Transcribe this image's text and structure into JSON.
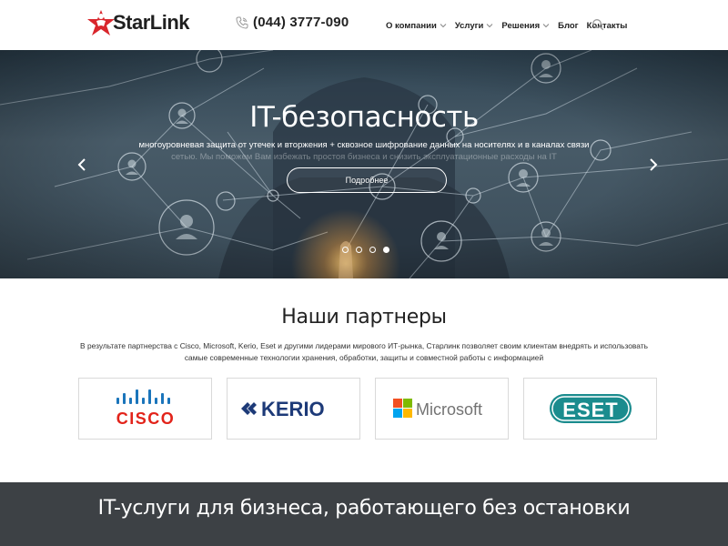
{
  "header": {
    "logo_text": "StarLink",
    "phone": "(044) 3777-090",
    "nav": [
      {
        "label": "О компании",
        "dropdown": true
      },
      {
        "label": "Услуги",
        "dropdown": true
      },
      {
        "label": "Решения",
        "dropdown": true
      },
      {
        "label": "Блог",
        "dropdown": false
      },
      {
        "label": "Контакты",
        "dropdown": false
      }
    ]
  },
  "hero": {
    "title": "IT-безопасность",
    "subtitle": "многоуровневая защита от утечек и вторжения + сквозное шифрование данных на носителях и в каналах связи",
    "subtitle_faded": "сетью. Мы поможем Вам избежать простоя бизнеса и снизить эксплуатационные расходы на IT",
    "button_label": "Подробнее",
    "slides": 4,
    "active_slide": 4
  },
  "partners": {
    "title": "Наши партнеры",
    "description": "В результате партнерства с Cisco, Microsoft, Kerio, Eset и другими лидерами мирового ИТ-рынка, Старлинк позволяет своим клиентам внедрять и использовать самые современные технологии хранения, обработки, защиты и совместной работы с информацией",
    "logos": [
      {
        "name": "cisco",
        "text": "CISCO"
      },
      {
        "name": "kerio",
        "text": "KERIO"
      },
      {
        "name": "microsoft",
        "text": "Microsoft"
      },
      {
        "name": "eset",
        "text": "ESET"
      }
    ]
  },
  "band": {
    "title": "IT-услуги для бизнеса, работающего без остановки"
  },
  "colors": {
    "logo_red": "#d9262c",
    "cisco_blue": "#1b75bb",
    "cisco_red": "#e2231a",
    "kerio_navy": "#1d3a78",
    "eset_teal": "#1b8c8e",
    "band": "#3d4145"
  }
}
